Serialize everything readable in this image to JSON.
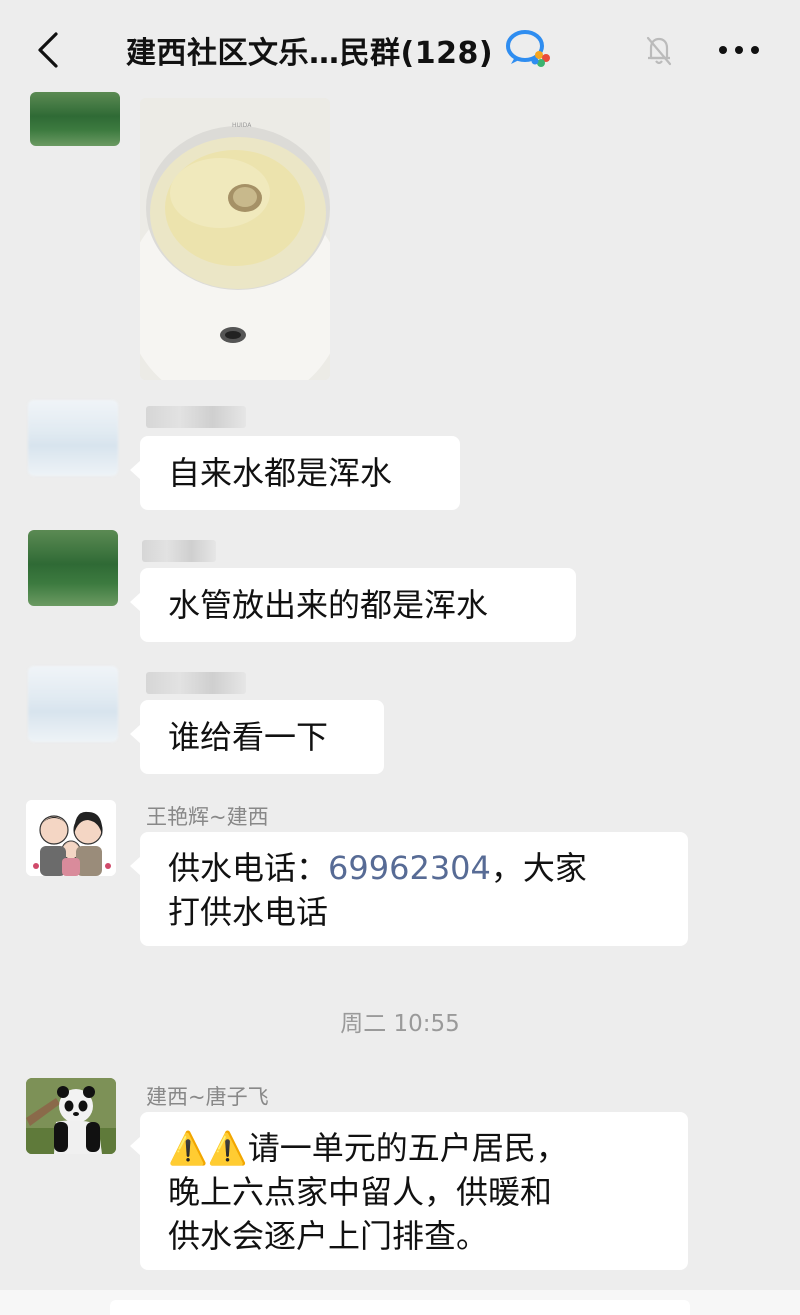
{
  "header": {
    "back_icon": "chevron-left-icon",
    "title": "建西社区文乐…民群(128)",
    "chat_icon": "wecom-chat-icon",
    "mute_icon": "bell-off-icon",
    "more_icon": "more-dots-icon"
  },
  "messages": [
    {
      "type": "image",
      "description_icon": "sink-photo"
    },
    {
      "sender": "",
      "text": "自来水都是浑水"
    },
    {
      "sender": "",
      "text": "水管放出来的都是浑水"
    },
    {
      "sender": "",
      "text": "谁给看一下"
    },
    {
      "sender": "王艳辉~建西",
      "text_before": "供水电话：",
      "phone": "69962304",
      "text_after": "，大家",
      "line2": "打供水电话"
    },
    {
      "sender": "建西~唐子飞",
      "line1": "⚠️⚠️请一单元的五户居民，",
      "line2": "晚上六点家中留人，供暖和",
      "line3": "供水会逐户上门排查。"
    }
  ],
  "timestamp": "周二 10:55",
  "colors": {
    "background": "#ededed",
    "bubble": "#ffffff",
    "link": "#576b95",
    "meta_text": "#888888"
  }
}
